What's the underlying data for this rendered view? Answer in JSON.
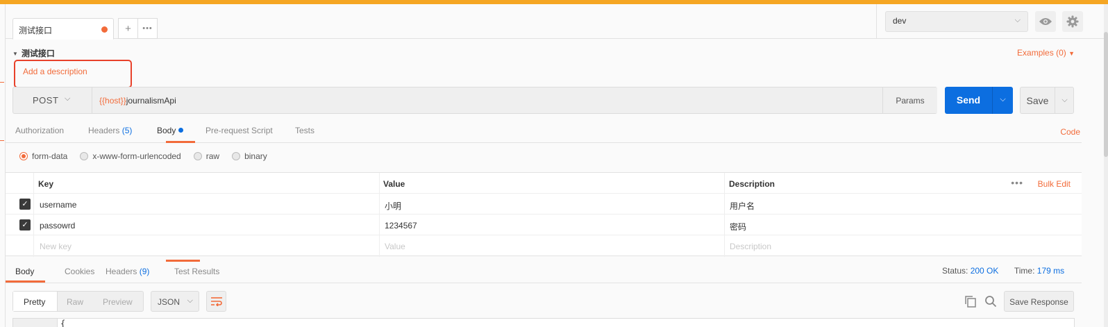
{
  "tabs": [
    {
      "label": "测试接口",
      "unsaved": true
    }
  ],
  "tab_controls": {
    "new_tab": "+",
    "more": "•••"
  },
  "environment": {
    "selected": "dev"
  },
  "request": {
    "name": "测试接口",
    "examples_label": "Examples (0)",
    "description_link": "Add a description",
    "method": "POST",
    "url_var": "{{host}}",
    "url_path": "journalismApi",
    "params_label": "Params",
    "send_label": "Send",
    "save_label": "Save"
  },
  "request_tabs": [
    {
      "label": "Authorization",
      "count": ""
    },
    {
      "label": "Headers",
      "count": "(5)"
    },
    {
      "label": "Body",
      "count": ""
    },
    {
      "label": "Pre-request Script",
      "count": ""
    },
    {
      "label": "Tests",
      "count": ""
    }
  ],
  "code_label": "Code",
  "body_modes": [
    {
      "label": "form-data",
      "selected": true
    },
    {
      "label": "x-www-form-urlencoded",
      "selected": false
    },
    {
      "label": "raw",
      "selected": false
    },
    {
      "label": "binary",
      "selected": false
    }
  ],
  "table": {
    "headers": {
      "key": "Key",
      "value": "Value",
      "description": "Description"
    },
    "bulk_edit": "Bulk Edit",
    "more": "•••",
    "rows": [
      {
        "checked": true,
        "key": "username",
        "value": "小明",
        "description": "用户名"
      },
      {
        "checked": true,
        "key": "passowrd",
        "value": "1234567",
        "description": "密码"
      }
    ],
    "placeholder": {
      "key": "New key",
      "value": "Value",
      "description": "Description"
    }
  },
  "response_tabs": [
    {
      "label": "Body",
      "count": ""
    },
    {
      "label": "Cookies",
      "count": ""
    },
    {
      "label": "Headers",
      "count": "(9)"
    },
    {
      "label": "Test Results",
      "count": ""
    }
  ],
  "response_status": {
    "status_label": "Status:",
    "status_value": "200 OK",
    "time_label": "Time:",
    "time_value": "179 ms"
  },
  "response_toolbar": {
    "formats": [
      "Pretty",
      "Raw",
      "Preview"
    ],
    "language": "JSON",
    "save_response": "Save Response"
  },
  "response_body_first_line": "{",
  "colors": {
    "accent": "#f26b3a",
    "primary": "#0c6ee0",
    "topbar": "#f5a623",
    "highlight": "#e8412a"
  }
}
